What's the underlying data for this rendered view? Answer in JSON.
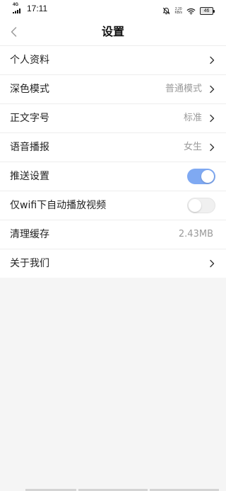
{
  "status_bar": {
    "network": "4G",
    "time": "17:11",
    "speed_value": "2.20",
    "speed_unit": "KB/s",
    "battery": "46",
    "icons": [
      "signal-icon",
      "mute-bell-icon",
      "wifi-icon",
      "battery-icon"
    ]
  },
  "header": {
    "title": "设置",
    "back_icon": "chevron-left-icon"
  },
  "settings": {
    "items": [
      {
        "label": "个人资料",
        "value": "",
        "control": "chevron"
      },
      {
        "label": "深色模式",
        "value": "普通模式",
        "control": "chevron"
      },
      {
        "label": "正文字号",
        "value": "标准",
        "control": "chevron"
      },
      {
        "label": "语音播报",
        "value": "女生",
        "control": "chevron"
      },
      {
        "label": "推送设置",
        "value": "",
        "control": "toggle",
        "toggle_on": true
      },
      {
        "label": "仅wifi下自动播放视频",
        "value": "",
        "control": "toggle",
        "toggle_on": false
      },
      {
        "label": "清理缓存",
        "value": "2.43MB",
        "control": "none"
      },
      {
        "label": "关于我们",
        "value": "",
        "control": "chevron"
      }
    ]
  },
  "colors": {
    "toggle_on": "#7fa9f2",
    "toggle_off": "#f0f0f0",
    "value_text": "#9a9a9a",
    "background": "#f5f5f5"
  }
}
